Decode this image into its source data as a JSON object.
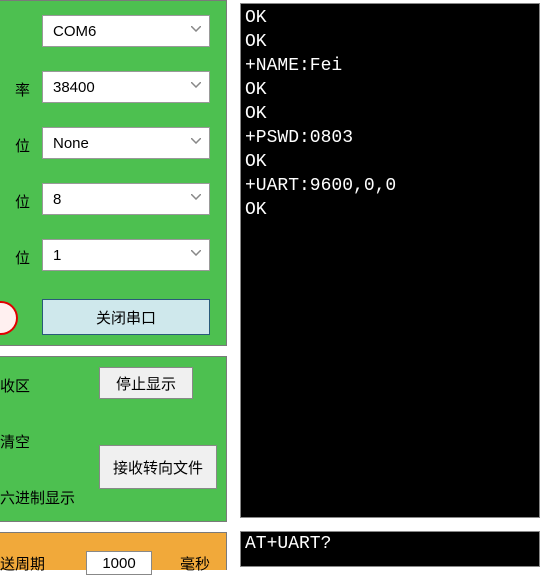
{
  "serial": {
    "port_label": "",
    "port_value": "COM6",
    "baud_label": "率",
    "baud_value": "38400",
    "parity_label": "位",
    "parity_value": "None",
    "databits_label": "位",
    "databits_value": "8",
    "stopbits_label": "位",
    "stopbits_value": "1",
    "close_btn": "关闭串口"
  },
  "recv": {
    "area_label": "收区",
    "stop_btn": "停止显示",
    "clear_label": "清空",
    "tofile_btn": "接收转向文件",
    "hex_label": "六进制显示"
  },
  "send": {
    "period_label": "送周期",
    "period_value": "1000",
    "unit_label": "毫秒"
  },
  "terminal_lines": [
    "OK",
    "OK",
    "+NAME:Fei",
    "OK",
    "OK",
    "+PSWD:0803",
    "OK",
    "+UART:9600,0,0",
    "OK"
  ],
  "command_input": "AT+UART?"
}
